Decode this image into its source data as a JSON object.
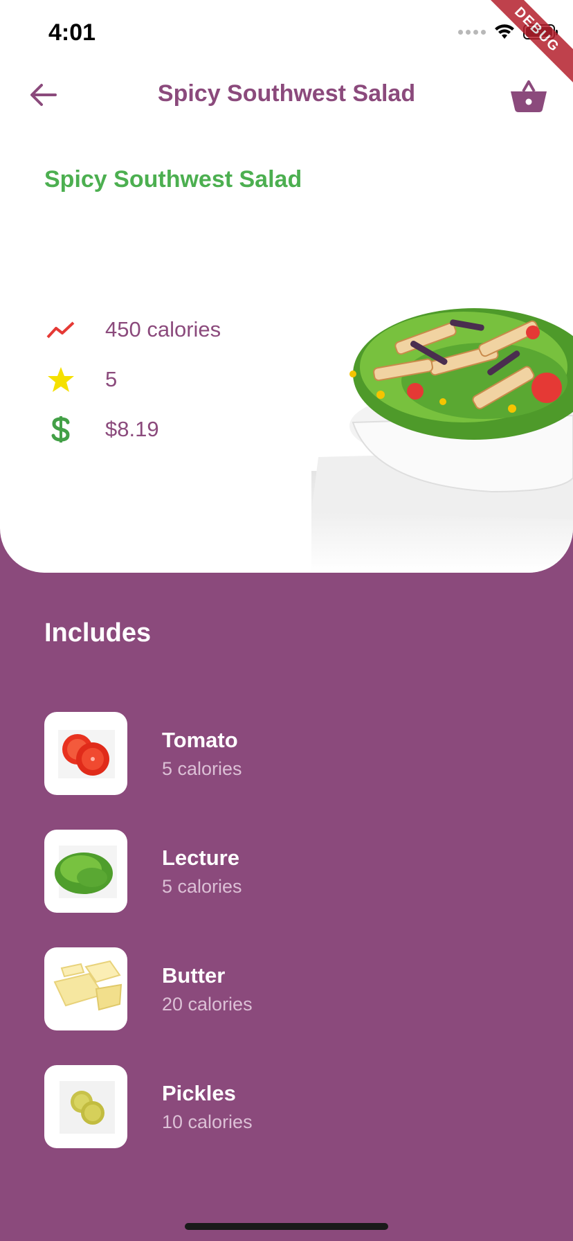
{
  "status_bar": {
    "time": "4:01"
  },
  "debug_banner": "DEBUG",
  "app_bar": {
    "title": "Spicy Southwest Salad",
    "back_icon": "arrow-left-icon",
    "basket_icon": "basket-icon"
  },
  "product": {
    "name": "Spicy Southwest Salad",
    "stats": [
      {
        "icon": "trending-up-icon",
        "text": "450 calories",
        "color": "#e53935"
      },
      {
        "icon": "star-icon",
        "text": "5",
        "color": "#f5e000"
      },
      {
        "icon": "dollar-icon",
        "text": "$8.19",
        "color": "#43a047"
      }
    ]
  },
  "includes": {
    "title": "Includes",
    "items": [
      {
        "name": "Tomato",
        "calories": "5 calories",
        "icon": "tomato-icon"
      },
      {
        "name": "Lecture",
        "calories": "5 calories",
        "icon": "lettuce-icon"
      },
      {
        "name": "Butter",
        "calories": "20 calories",
        "icon": "butter-icon"
      },
      {
        "name": "Pickles",
        "calories": "10 calories",
        "icon": "pickles-icon"
      }
    ]
  },
  "colors": {
    "primary": "#8b4a7c",
    "accent_green": "#4caf50",
    "background": "#ffffff"
  }
}
